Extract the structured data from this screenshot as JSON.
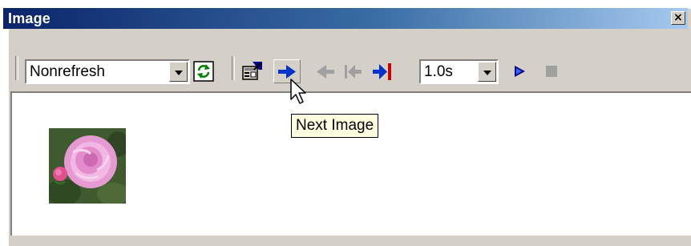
{
  "window": {
    "title": "Image",
    "close_label": "×"
  },
  "toolbar": {
    "refresh_mode": {
      "value": "Nonrefresh"
    },
    "interval": {
      "value": "1.0s"
    },
    "buttons": [
      {
        "id": "refresh",
        "icon": "refresh-icon"
      },
      {
        "id": "properties",
        "icon": "properties-icon"
      },
      {
        "id": "next",
        "icon": "next-arrow-icon",
        "state": "hover"
      },
      {
        "id": "previous",
        "icon": "previous-arrow-icon",
        "state": "disabled"
      },
      {
        "id": "first",
        "icon": "first-image-icon",
        "state": "disabled"
      },
      {
        "id": "last",
        "icon": "last-image-icon"
      },
      {
        "id": "play",
        "icon": "play-icon"
      },
      {
        "id": "stop",
        "icon": "stop-icon",
        "state": "disabled"
      }
    ]
  },
  "tooltip": {
    "text": "Next Image"
  },
  "colors": {
    "title_gradient_start": "#0a246a",
    "title_gradient_end": "#a6caf0",
    "arrow_blue": "#0033cc",
    "arrow_red": "#cc0000",
    "disabled_gray": "#a0a0a0",
    "tooltip_bg": "#ffffe1"
  }
}
